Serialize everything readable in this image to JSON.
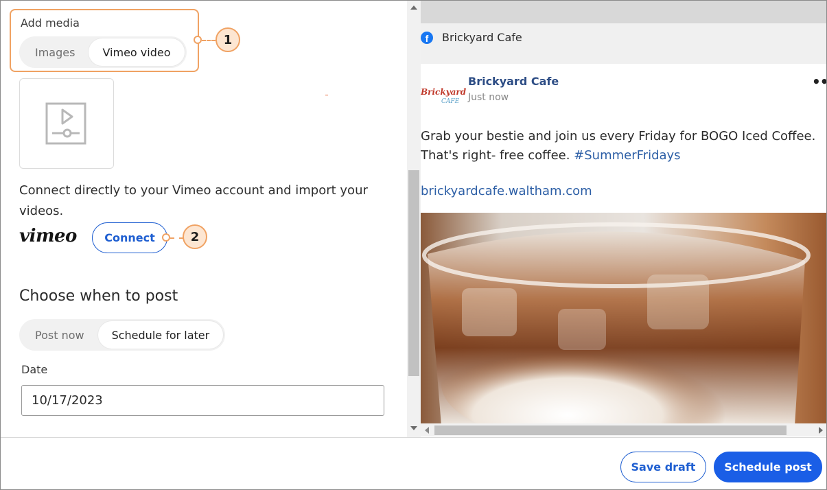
{
  "media": {
    "label": "Add media",
    "tabs": [
      {
        "label": "Images",
        "active": false
      },
      {
        "label": "Vimeo video",
        "active": true
      }
    ],
    "thumbnail_icon": "video-file-icon"
  },
  "vimeo": {
    "description": "Connect directly to your Vimeo account and import your videos.",
    "logo_text": "vimeo",
    "connect_label": "Connect"
  },
  "callouts": {
    "one": "1",
    "two": "2",
    "color": "#f0a263"
  },
  "schedule": {
    "title": "Choose when to post",
    "tabs": [
      {
        "label": "Post now",
        "active": false
      },
      {
        "label": "Schedule for later",
        "active": true
      }
    ],
    "date_label": "Date",
    "date_value": "10/17/2023"
  },
  "preview": {
    "network_icon": "facebook-icon",
    "network_page": "Brickyard Cafe",
    "post": {
      "page_name": "Brickyard Cafe",
      "time": "Just now",
      "avatar_text_1": "Brickyard",
      "avatar_text_2": "CAFE",
      "more_icon": "more-options-icon",
      "text_line_1": "Grab your bestie and join us every Friday for BOGO Iced Coffee.",
      "text_line_2": "That's right- free coffee. ",
      "hashtag": "#SummerFridays",
      "link": "brickyardcafe.waltham.com",
      "image": "iced-coffee-photo"
    }
  },
  "footer": {
    "save_draft": "Save draft",
    "schedule_post": "Schedule post"
  },
  "colors": {
    "primary": "#1a5ee6",
    "link": "#2d5fa6",
    "facebook": "#1877f2"
  }
}
